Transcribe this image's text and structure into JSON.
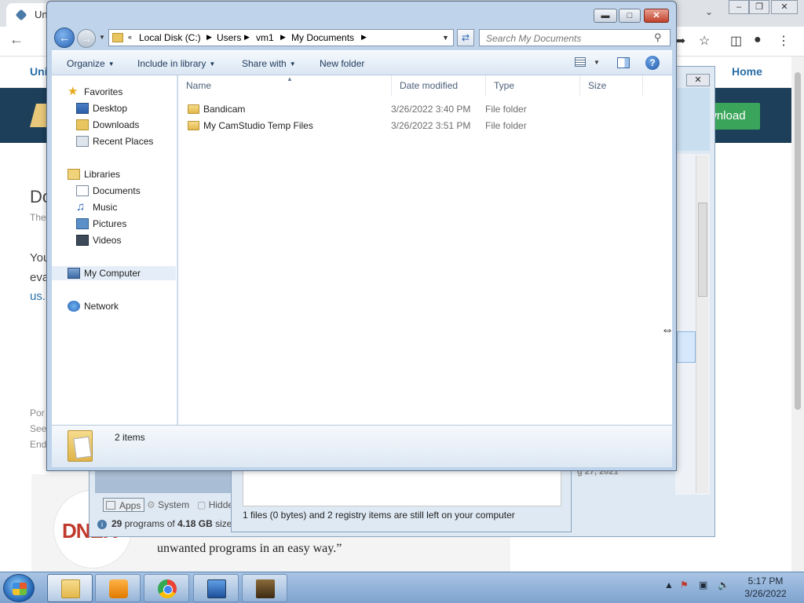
{
  "browser": {
    "tab_title": "Un",
    "nav_left": "Uni",
    "nav_home": "Home",
    "download_button": "wnload",
    "body_fragments": [
      "Do",
      "The",
      "You",
      "eva",
      "us.",
      "Por",
      "See",
      "End"
    ],
    "quote": "unwanted programs in an easy way.”",
    "logo_text": "DNEK"
  },
  "revo": {
    "tabs": [
      "Apps",
      "System",
      "Hidde"
    ],
    "status_count": "29",
    "status_size": "4.18 GB",
    "status_text_mid": " programs of ",
    "status_text_end": " size",
    "dialog_message": "1 files (0 bytes) and 2 registry items are still left on your computer",
    "date_fragment": "g 27, 2021"
  },
  "explorer": {
    "address_crumbs": [
      "Local Disk (C:)",
      "Users",
      "vm1",
      "My Documents"
    ],
    "search_placeholder": "Search My Documents",
    "commands": {
      "organize": "Organize",
      "include_library": "Include in library",
      "share_with": "Share with",
      "new_folder": "New folder"
    },
    "nav": {
      "favorites": "Favorites",
      "desktop": "Desktop",
      "downloads": "Downloads",
      "recent": "Recent Places",
      "libraries": "Libraries",
      "documents": "Documents",
      "music": "Music",
      "pictures": "Pictures",
      "videos": "Videos",
      "computer": "My Computer",
      "network": "Network"
    },
    "columns": [
      "Name",
      "Date modified",
      "Type",
      "Size"
    ],
    "files": [
      {
        "name": "Bandicam",
        "date": "3/26/2022 3:40 PM",
        "type": "File folder"
      },
      {
        "name": "My CamStudio Temp Files",
        "date": "3/26/2022 3:51 PM",
        "type": "File folder"
      }
    ],
    "item_count": "2 items"
  },
  "taskbar": {
    "time": "5:17 PM",
    "date": "3/26/2022"
  }
}
